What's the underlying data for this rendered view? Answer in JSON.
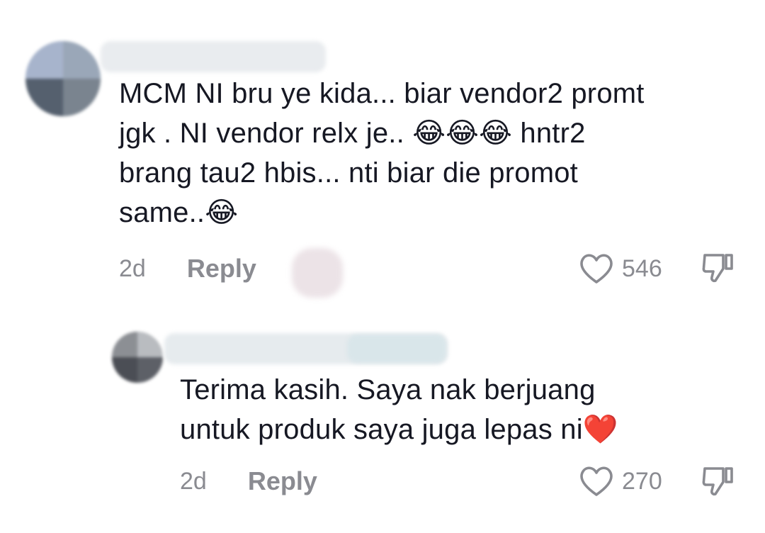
{
  "comments": [
    {
      "text": "MCM NI bru ye kida... biar vendor2 promt\njgk . NI vendor relx je.. 😂😂😂 hntr2\nbrang tau2 hbis... nti biar die promot\nsame..😂",
      "time": "2d",
      "reply_label": "Reply",
      "likes": "546",
      "icons": {
        "like": "heart-outline-icon",
        "dislike": "thumbs-down-icon"
      }
    },
    {
      "text": "Terima kasih. Saya nak berjuang\nuntuk produk saya juga lepas ni❤️",
      "time": "2d",
      "reply_label": "Reply",
      "likes": "270",
      "icons": {
        "like": "heart-outline-icon",
        "dislike": "thumbs-down-icon"
      }
    }
  ]
}
